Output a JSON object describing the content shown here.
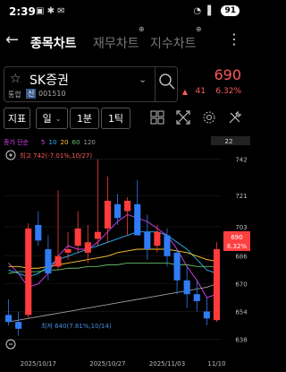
{
  "status_bar": {
    "time": "2:39",
    "battery": "91"
  },
  "nav": {
    "back_icon": "←",
    "tabs": [
      {
        "label": "종목차트",
        "active": true
      },
      {
        "label": "재무차트",
        "active": false
      },
      {
        "label": "지수차트",
        "active": false
      }
    ]
  },
  "stock": {
    "name": "SK증권",
    "market": "통합",
    "credit_badge": "신",
    "code": "001510",
    "price": "690",
    "change_arrow": "▲",
    "change": "41",
    "change_rate": "6.32%"
  },
  "toolbar": {
    "indicator_label": "지표",
    "period_label": "일",
    "minute_label": "1분",
    "tick_label": "1틱"
  },
  "chart_data": {
    "type": "candlestick",
    "ma_legend": {
      "title": "종가 단순",
      "periods": [
        "5",
        "10",
        "20",
        "60",
        "120"
      ],
      "colors": [
        "#e040fb",
        "#29b6f6",
        "#ffca28",
        "#66bb6a",
        "#9e9e9e"
      ]
    },
    "count_badge": "22",
    "y_ticks": [
      "742",
      "721",
      "703",
      "686",
      "670",
      "654",
      "638"
    ],
    "x_ticks": [
      "2025/10/17",
      "2025/10/27",
      "2025/11/03",
      "11/10"
    ],
    "high_label": "최고 742(-7.01%,10/27)",
    "low_label": "최저 640(7.81%,10/14)",
    "current_price": "690",
    "current_rate": "6.32%",
    "ylim": [
      632,
      748
    ],
    "candles": [
      {
        "o": 652,
        "h": 661,
        "l": 646,
        "c": 648
      },
      {
        "o": 648,
        "h": 654,
        "l": 640,
        "c": 644
      },
      {
        "o": 652,
        "h": 705,
        "l": 650,
        "c": 702
      },
      {
        "o": 704,
        "h": 712,
        "l": 692,
        "c": 695
      },
      {
        "o": 690,
        "h": 698,
        "l": 672,
        "c": 676
      },
      {
        "o": 680,
        "h": 724,
        "l": 678,
        "c": 686
      },
      {
        "o": 688,
        "h": 700,
        "l": 684,
        "c": 690
      },
      {
        "o": 692,
        "h": 712,
        "l": 688,
        "c": 702
      },
      {
        "o": 688,
        "h": 704,
        "l": 682,
        "c": 694
      },
      {
        "o": 696,
        "h": 742,
        "l": 692,
        "c": 700
      },
      {
        "o": 702,
        "h": 732,
        "l": 694,
        "c": 718
      },
      {
        "o": 716,
        "h": 722,
        "l": 704,
        "c": 708
      },
      {
        "o": 712,
        "h": 720,
        "l": 698,
        "c": 718
      },
      {
        "o": 716,
        "h": 730,
        "l": 700,
        "c": 698
      },
      {
        "o": 700,
        "h": 710,
        "l": 684,
        "c": 690
      },
      {
        "o": 692,
        "h": 704,
        "l": 688,
        "c": 700
      },
      {
        "o": 698,
        "h": 702,
        "l": 680,
        "c": 686
      },
      {
        "o": 688,
        "h": 690,
        "l": 664,
        "c": 672
      },
      {
        "o": 672,
        "h": 680,
        "l": 656,
        "c": 664
      },
      {
        "o": 664,
        "h": 672,
        "l": 654,
        "c": 660
      },
      {
        "o": 654,
        "h": 662,
        "l": 646,
        "c": 650
      },
      {
        "o": 649,
        "h": 694,
        "l": 648,
        "c": 690
      }
    ],
    "ma_series": [
      {
        "name": "5",
        "values": [
          682,
          676,
          668,
          670,
          676,
          686,
          692,
          690,
          690,
          694,
          700,
          706,
          710,
          708,
          706,
          702,
          698,
          690,
          680,
          672,
          662,
          664
        ]
      },
      {
        "name": "10",
        "values": [
          678,
          676,
          674,
          676,
          680,
          684,
          686,
          688,
          690,
          692,
          694,
          696,
          698,
          700,
          700,
          700,
          698,
          694,
          690,
          684,
          678,
          676
        ]
      },
      {
        "name": "20",
        "values": [
          680,
          680,
          679,
          679,
          680,
          681,
          682,
          683,
          684,
          685,
          686,
          688,
          689,
          690,
          690,
          690,
          690,
          689,
          688,
          686,
          684,
          683
        ]
      },
      {
        "name": "60",
        "values": [
          676,
          677,
          677,
          677,
          678,
          678,
          679,
          679,
          680,
          680,
          681,
          681,
          682,
          682,
          682,
          682,
          682,
          681,
          681,
          680,
          680,
          680
        ]
      },
      {
        "name": "120",
        "values": [
          648,
          649,
          650,
          651,
          652,
          653,
          654,
          655,
          656,
          657,
          658,
          659,
          660,
          661,
          662,
          663,
          664,
          665,
          666,
          667,
          668,
          670
        ]
      }
    ]
  }
}
